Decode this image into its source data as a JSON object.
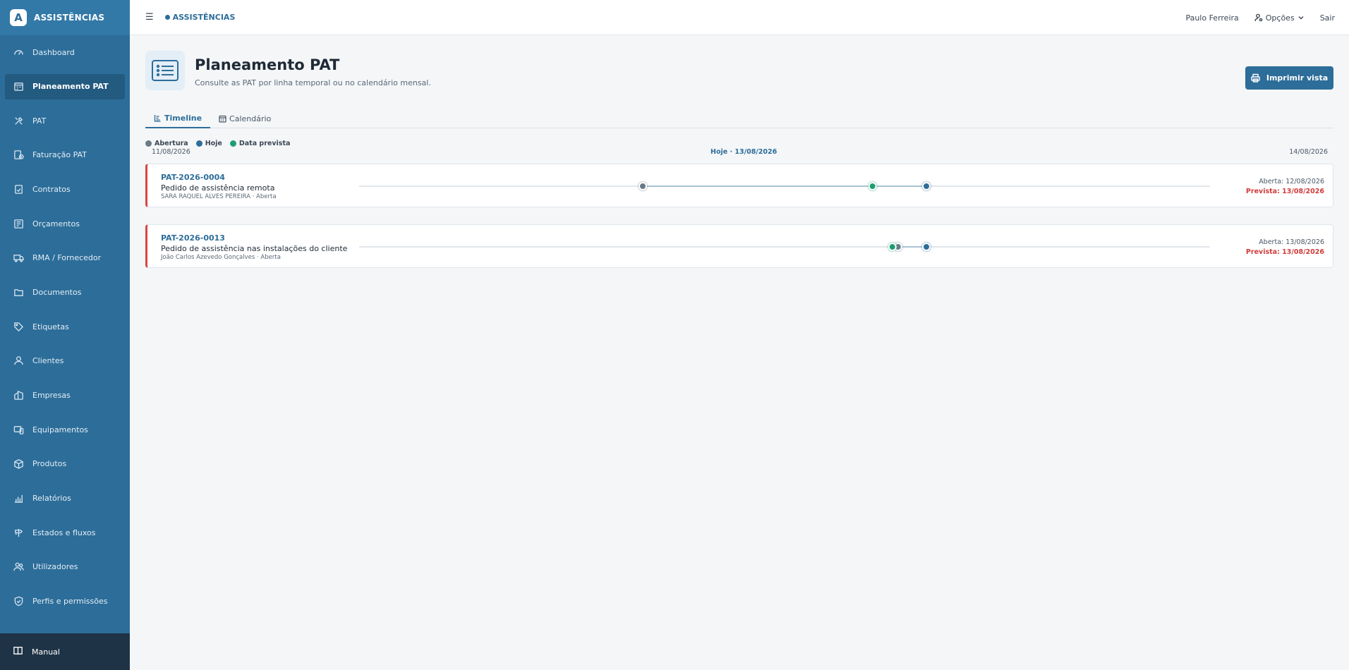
{
  "app": {
    "brand": "ASSISTÊNCIAS",
    "logo_letter": "A",
    "top_brand": "ASSISTÊNCIAS"
  },
  "sidebar": {
    "items": [
      {
        "label": "Dashboard",
        "icon": "gauge-icon"
      },
      {
        "label": "Planeamento PAT",
        "icon": "calendar-plan-icon",
        "active": true
      },
      {
        "label": "PAT",
        "icon": "tools-icon"
      },
      {
        "label": "Faturação PAT",
        "icon": "invoice-clock-icon"
      },
      {
        "label": "Contratos",
        "icon": "contract-check-icon"
      },
      {
        "label": "Orçamentos",
        "icon": "budget-icon"
      },
      {
        "label": "RMA / Fornecedor",
        "icon": "truck-icon"
      },
      {
        "label": "Documentos",
        "icon": "folder-icon"
      },
      {
        "label": "Etiquetas",
        "icon": "tag-icon"
      },
      {
        "label": "Clientes",
        "icon": "user-icon"
      },
      {
        "label": "Empresas",
        "icon": "building-icon"
      },
      {
        "label": "Equipamentos",
        "icon": "devices-icon"
      },
      {
        "label": "Produtos",
        "icon": "box-icon"
      },
      {
        "label": "Relatórios",
        "icon": "chart-icon"
      },
      {
        "label": "Estados e fluxos",
        "icon": "signpost-icon"
      },
      {
        "label": "Utilizadores",
        "icon": "users-icon"
      },
      {
        "label": "Perfis e permissões",
        "icon": "shield-icon"
      }
    ],
    "manual": "Manual"
  },
  "topbar": {
    "menu_glyph": "☰",
    "user": "Paulo Ferreira",
    "options": "Opções",
    "logout": "Sair"
  },
  "page": {
    "title": "Planeamento PAT",
    "subtitle": "Consulte as PAT por linha temporal ou no calendário mensal.",
    "print_button": "Imprimir vista"
  },
  "tabs": [
    {
      "label": "Timeline",
      "active": true
    },
    {
      "label": "Calendário",
      "active": false
    }
  ],
  "legend": [
    {
      "label": "Abertura",
      "color": "#6b7a88"
    },
    {
      "label": "Hoje",
      "color": "#2d6d99"
    },
    {
      "label": "Data prevista",
      "color": "#1f9d72"
    }
  ],
  "timeline": {
    "start": "11/08/2026",
    "today_label": "Hoje · 13/08/2026",
    "end": "14/08/2026",
    "range_days": [
      0,
      3
    ],
    "today_day": 2
  },
  "cards": [
    {
      "code": "PAT-2026-0004",
      "description": "Pedido de assistência remota",
      "meta": "SARA RAQUEL ALVES PEREIRA · Aberta",
      "opened_label": "Aberta: 12/08/2026",
      "planned_label": "Prevista: 13/08/2026",
      "open_day": 1.0,
      "planned_day": 1.81
    },
    {
      "code": "PAT-2026-0013",
      "description": "Pedido de assistência nas instalações do cliente",
      "meta": "João Carlos Azevedo Gonçalves · Aberta",
      "opened_label": "Aberta: 13/08/2026",
      "planned_label": "Prevista: 13/08/2026",
      "open_day": 1.9,
      "planned_day": 1.88
    }
  ],
  "colors": {
    "accent": "#2d6d99",
    "open": "#6b7a88",
    "planned": "#1f9d72",
    "overdue": "#d64545"
  }
}
